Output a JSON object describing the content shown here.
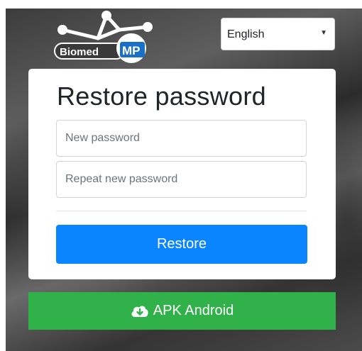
{
  "logo": {
    "text_left": "Biomed",
    "text_right": "MP"
  },
  "language_select": {
    "selected": "English"
  },
  "restore_card": {
    "title": "Restore password",
    "new_password_placeholder": "New password",
    "repeat_password_placeholder": "Repeat new password",
    "submit_label": "Restore"
  },
  "apk_button": {
    "label": "APK Android",
    "icon": "cloud-download-icon"
  },
  "colors": {
    "primary_button": "#0a84ff",
    "apk_button": "#30b14a",
    "logo_circle": "#1a6fc9"
  }
}
